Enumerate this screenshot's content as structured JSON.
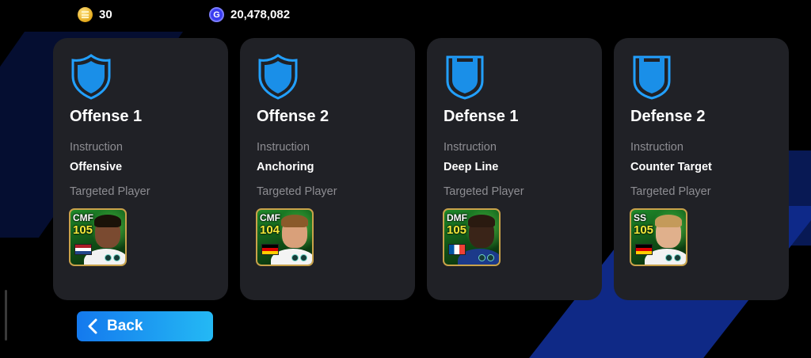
{
  "header": {
    "coins": {
      "icon": "coin-icon",
      "value": "30"
    },
    "gp": {
      "icon": "gp-icon",
      "symbol": "G",
      "value": "20,478,082"
    }
  },
  "colors": {
    "accent": "#1a8fe8",
    "card_bg": "#202126",
    "label_gray": "#8d8d92",
    "rating_yellow": "#f4ea3a"
  },
  "cards": [
    {
      "icon": "offense-shield-icon",
      "title": "Offense 1",
      "instruction_label": "Instruction",
      "instruction_value": "Offensive",
      "target_label": "Targeted Player",
      "player": {
        "position": "CMF",
        "rating": "105",
        "flag": "Netherlands"
      }
    },
    {
      "icon": "offense-shield-icon",
      "title": "Offense 2",
      "instruction_label": "Instruction",
      "instruction_value": "Anchoring",
      "target_label": "Targeted Player",
      "player": {
        "position": "CMF",
        "rating": "104",
        "flag": "Germany"
      }
    },
    {
      "icon": "defense-shield-icon",
      "title": "Defense 1",
      "instruction_label": "Instruction",
      "instruction_value": "Deep Line",
      "target_label": "Targeted Player",
      "player": {
        "position": "DMF",
        "rating": "105",
        "flag": "France"
      }
    },
    {
      "icon": "defense-shield-icon",
      "title": "Defense 2",
      "instruction_label": "Instruction",
      "instruction_value": "Counter Target",
      "target_label": "Targeted Player",
      "player": {
        "position": "SS",
        "rating": "105",
        "flag": "Germany"
      }
    }
  ],
  "footer": {
    "back_label": "Back",
    "back_icon": "chevron-left-icon"
  }
}
